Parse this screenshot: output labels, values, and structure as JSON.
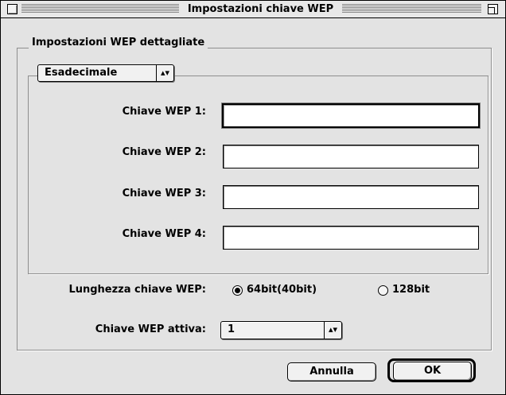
{
  "window": {
    "title": "Impostazioni chiave WEP"
  },
  "group": {
    "title": "Impostazioni WEP dettagliate"
  },
  "encoding": {
    "selected": "Esadecimale"
  },
  "keys": [
    {
      "label": "Chiave WEP 1:",
      "value": ""
    },
    {
      "label": "Chiave WEP 2:",
      "value": ""
    },
    {
      "label": "Chiave WEP 3:",
      "value": ""
    },
    {
      "label": "Chiave WEP 4:",
      "value": ""
    }
  ],
  "key_length": {
    "label": "Lunghezza chiave WEP:",
    "options": [
      "64bit(40bit)",
      "128bit"
    ],
    "selected": "64bit(40bit)"
  },
  "active_key": {
    "label": "Chiave WEP attiva:",
    "selected": "1"
  },
  "buttons": {
    "cancel": "Annulla",
    "ok": "OK"
  },
  "icons": {
    "popup_arrows": "updown-arrows-icon",
    "close_box": "close-box-icon",
    "zoom_box": "zoom-box-icon"
  },
  "colors": {
    "window_bg": "#e3e3e3",
    "field_bg": "#ffffff",
    "text": "#000000"
  }
}
